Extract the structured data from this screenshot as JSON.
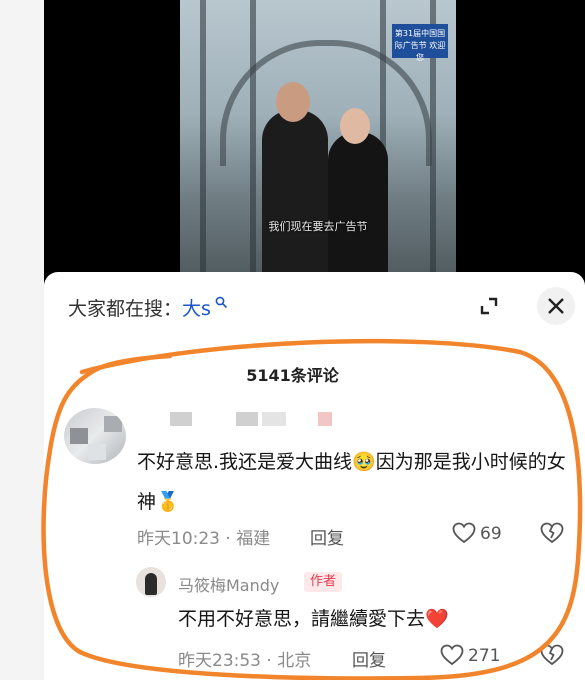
{
  "video": {
    "banner_text": "第31届中国国际广告节 欢迎您",
    "subtitle": "我们现在要去广告节"
  },
  "search_tip": {
    "prefix": "大家都在搜：",
    "keyword": "大s",
    "icon": "search-icon"
  },
  "comments_header": {
    "count_label": "5141条评论"
  },
  "comment": {
    "text": "不好意思.我还是爱大曲线🥹因为那是我小时候的女神🥇",
    "time": "昨天10:23",
    "location": "福建",
    "reply_label": "回复",
    "like_count": "69"
  },
  "reply": {
    "username": "马筱梅Mandy",
    "author_tag": "作者",
    "text": "不用不好意思，請繼續愛下去❤️",
    "time": "昨天23:53",
    "location": "北京",
    "reply_label": "回复",
    "like_count": "271"
  },
  "colors": {
    "accent_blue": "#1a57c7",
    "author_red": "#e53b52",
    "annotation_orange": "#f2852b"
  }
}
